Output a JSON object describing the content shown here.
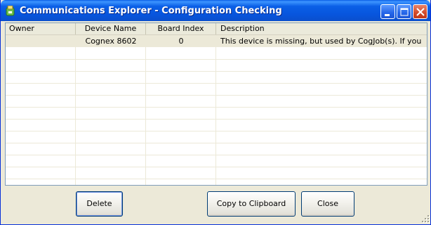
{
  "window": {
    "title": "Communications Explorer - Configuration Checking",
    "icon": "app-icon",
    "controls": [
      "minimize-icon",
      "maximize-icon",
      "close-icon"
    ]
  },
  "table": {
    "columns": [
      "Owner",
      "Device Name",
      "Board Index",
      "Description"
    ],
    "rows": [
      {
        "owner": "",
        "device_name": "Cognex 8602",
        "board_index": "0",
        "description": "This device is missing, but used by CogJob(s). If you delete..."
      }
    ]
  },
  "buttons": {
    "delete": "Delete",
    "copy": "Copy to Clipboard",
    "close": "Close"
  },
  "colors": {
    "title_bar": "#0a5fe6",
    "window_bg": "#ece9d8",
    "selected_row": "#ece9d8",
    "close_button": "#d24a2a"
  }
}
